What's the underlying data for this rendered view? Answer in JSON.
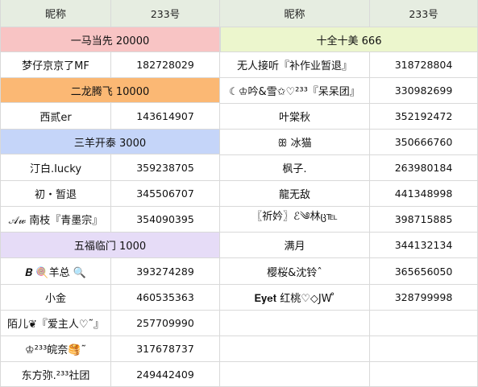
{
  "colors": {
    "header_bg": "#e6ede1",
    "tier1_bg": "#f8c4c4",
    "tier2_bg": "#fbb874",
    "tier3_bg": "#c5d5f9",
    "tier4_bg": "#e6dcf7",
    "tier_right_bg": "#ecf6cd"
  },
  "left": {
    "header": {
      "name": "昵称",
      "qq": "233号"
    },
    "sections": [
      {
        "title": "一马当先 20000",
        "color_key": "tier1_bg",
        "rows": [
          {
            "name": "梦仔京京了MF",
            "qq": "182728029"
          }
        ]
      },
      {
        "title": "二龙腾飞 10000",
        "color_key": "tier2_bg",
        "rows": [
          {
            "name": "西贰er",
            "qq": "143614907"
          }
        ]
      },
      {
        "title": "三羊开泰 3000",
        "color_key": "tier3_bg",
        "rows": [
          {
            "name": "汀白.Iucky",
            "qq": "359238705"
          },
          {
            "name": "初・暂退",
            "qq": "345506707"
          },
          {
            "name": "𝒜𝓌 南枝『青墨宗』",
            "qq": "354090395"
          }
        ]
      },
      {
        "title": "五福临门 1000",
        "color_key": "tier4_bg",
        "rows": [
          {
            "name": "𝑩 🍭羊总 🔍",
            "qq": "393274289"
          },
          {
            "name": "小金",
            "qq": "460535363"
          },
          {
            "name": "陌儿❦『爱主人♡˜』",
            "qq": "257709990"
          },
          {
            "name": "♔²³³皖奈🥞˜",
            "qq": "317678737"
          },
          {
            "name": "东方弥.²³³社团",
            "qq": "249442409"
          }
        ]
      }
    ]
  },
  "right": {
    "header": {
      "name": "昵称",
      "qq": "233号"
    },
    "section": {
      "title": "十全十美 666",
      "color_key": "tier_right_bg"
    },
    "rows": [
      {
        "name": "无人接听『补作业暂退』",
        "qq": "318728804"
      },
      {
        "name": "☾♔吟&雪✩♡²³³『呆呆团』",
        "qq": "330982699"
      },
      {
        "name": "叶棠秋",
        "qq": "352192472"
      },
      {
        "name": "ꕥ 冰猫",
        "qq": "350666760"
      },
      {
        "name": "枫子.",
        "qq": "263980184"
      },
      {
        "name": "龍无敌",
        "qq": "441348998"
      },
      {
        "name": "〖祈妗〗ℰ༄林ც℡",
        "qq": "398715885"
      },
      {
        "name": "满月",
        "qq": "344132134"
      },
      {
        "name": "樱桜&沈铃ˆ",
        "qq": "365656050"
      },
      {
        "name": "𝐄𝐲𝐞𝐭 红桃♡◇JW ̊",
        "qq": "328799998"
      },
      {
        "name": "",
        "qq": ""
      },
      {
        "name": "",
        "qq": ""
      },
      {
        "name": "",
        "qq": ""
      }
    ]
  }
}
